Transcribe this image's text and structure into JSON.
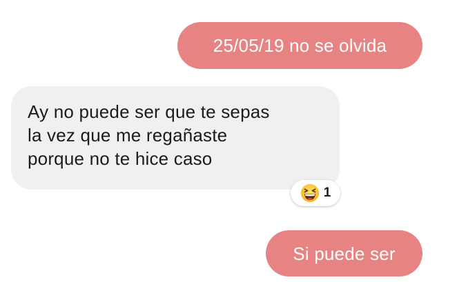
{
  "messages": [
    {
      "direction": "outgoing",
      "text": "25/05/19 no se olvida"
    },
    {
      "direction": "incoming",
      "lines": [
        "Ay no puede ser que te sepas",
        "la vez que me regañaste",
        "porque no te hice caso"
      ],
      "reaction": {
        "icon": "grinning-squinting-face-icon",
        "count": "1"
      }
    },
    {
      "direction": "outgoing",
      "text": "Si puede ser"
    }
  ],
  "colors": {
    "outgoing_bubble": "#e88383",
    "incoming_bubble": "#f0f0f0",
    "outgoing_text": "#ffffff",
    "incoming_text": "#1c1c1c"
  }
}
